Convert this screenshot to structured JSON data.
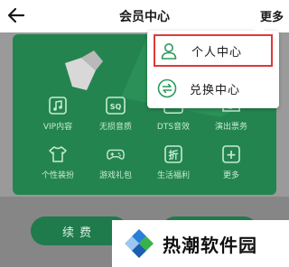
{
  "header": {
    "title": "会员中心",
    "more_label": "更多"
  },
  "dropdown": {
    "items": [
      {
        "label": "个人中心",
        "icon": "person-icon",
        "highlighted": true
      },
      {
        "label": "兑换中心",
        "icon": "exchange-icon",
        "highlighted": false
      }
    ]
  },
  "benefits": [
    {
      "label": "VIP内容",
      "icon": "music-note-icon"
    },
    {
      "label": "无损音质",
      "icon": "sq-icon",
      "glyph": "SQ"
    },
    {
      "label": "DTS音效",
      "icon": "dts-icon",
      "glyph": "DTS"
    },
    {
      "label": "演出票务",
      "icon": "ticket-icon"
    },
    {
      "label": "个性装扮",
      "icon": "tshirt-icon"
    },
    {
      "label": "游戏礼包",
      "icon": "gamepad-icon"
    },
    {
      "label": "生活福利",
      "icon": "discount-icon",
      "glyph": "折"
    },
    {
      "label": "更多",
      "icon": "plus-icon",
      "glyph": "+"
    }
  ],
  "actions": {
    "renew_label": "续费"
  },
  "watermark": {
    "text": "热潮软件园"
  },
  "colors": {
    "brand_green": "#24844f",
    "highlight_red": "#e03838"
  }
}
